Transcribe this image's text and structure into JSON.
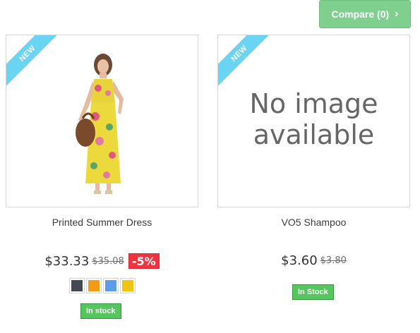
{
  "compare": {
    "label": "Compare (0)"
  },
  "products": [
    {
      "badge": "NEW",
      "name": "Printed Summer Dress",
      "price": "$33.33",
      "old_price": "$35.08",
      "discount": "-5%",
      "swatches": [
        "#434a54",
        "#f39c11",
        "#5d9cec",
        "#f1c40f"
      ],
      "stock": "In stock"
    },
    {
      "badge": "NEW",
      "no_image_line1": "No image",
      "no_image_line2": "available",
      "name": "VO5 Shampoo",
      "price": "$3.60",
      "old_price": "$3.80",
      "stock": "In Stock"
    }
  ]
}
